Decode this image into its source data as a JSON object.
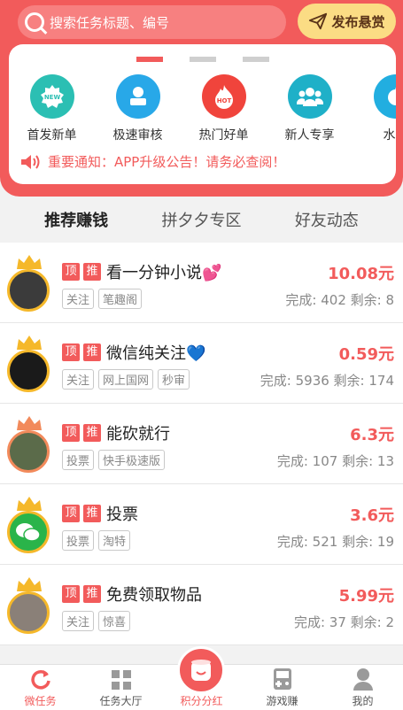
{
  "search": {
    "placeholder": "搜索任务标题、编号"
  },
  "publish": {
    "label": "发布悬赏"
  },
  "categories": [
    {
      "label": "首发新单",
      "icon": "new-badge-icon",
      "color": "#2bbfb3"
    },
    {
      "label": "极速审核",
      "icon": "reviewer-icon",
      "color": "#28a8e8"
    },
    {
      "label": "热门好单",
      "icon": "hot-flame-icon",
      "color": "#f0443c"
    },
    {
      "label": "新人专享",
      "icon": "group-users-icon",
      "color": "#1fb0c8"
    },
    {
      "label": "水果",
      "icon": "fruit-icon",
      "color": "#22aee0"
    }
  ],
  "notice": {
    "text": "重要通知：APP升级公告！请务必查阅！"
  },
  "tabs": [
    {
      "label": "推荐赚钱",
      "active": true
    },
    {
      "label": "拼夕夕专区",
      "active": false
    },
    {
      "label": "好友动态",
      "active": false
    }
  ],
  "badges": {
    "top": "顶",
    "push": "推"
  },
  "tasks": [
    {
      "title": "看一分钟小说💕",
      "tags": [
        "关注",
        "笔趣阁"
      ],
      "price": "10.08元",
      "stats": "完成: 402  剩余: 8",
      "crown": "gold"
    },
    {
      "title": "微信纯关注💙",
      "tags": [
        "关注",
        "网上国网",
        "秒审"
      ],
      "price": "0.59元",
      "stats": "完成: 5936  剩余: 174",
      "crown": "gold"
    },
    {
      "title": "能砍就行",
      "tags": [
        "投票",
        "快手极速版"
      ],
      "price": "6.3元",
      "stats": "完成: 107  剩余: 13",
      "crown": "orange"
    },
    {
      "title": "投票",
      "tags": [
        "投票",
        "淘特"
      ],
      "price": "3.6元",
      "stats": "完成: 521  剩余: 19",
      "crown": "gold"
    },
    {
      "title": "免费领取物品",
      "tags": [
        "关注",
        "惊喜"
      ],
      "price": "5.99元",
      "stats": "完成: 37  剩余: 2",
      "crown": "gold"
    }
  ],
  "nav": [
    {
      "label": "微任务",
      "icon": "refresh-icon",
      "active": true
    },
    {
      "label": "任务大厅",
      "icon": "grid-icon",
      "active": false
    },
    {
      "label": "积分分红",
      "icon": "cup-icon",
      "active": false
    },
    {
      "label": "游戏赚",
      "icon": "gamepad-icon",
      "active": false
    },
    {
      "label": "我的",
      "icon": "user-icon",
      "active": false
    }
  ]
}
